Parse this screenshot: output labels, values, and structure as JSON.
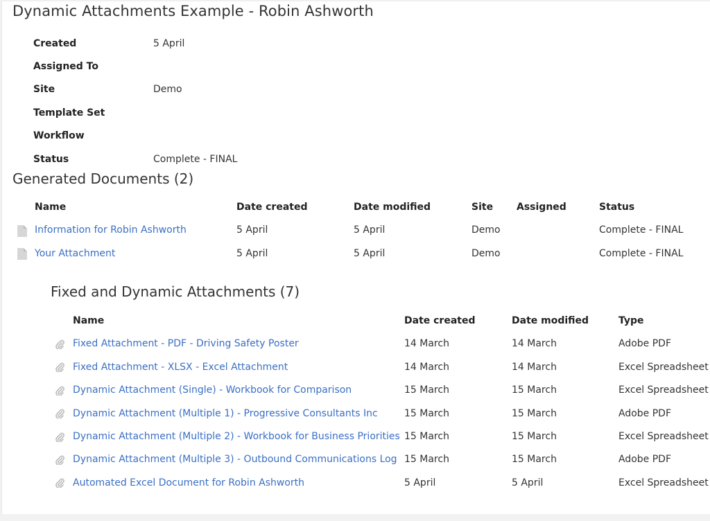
{
  "page": {
    "title": "Dynamic Attachments Example - Robin Ashworth"
  },
  "properties": [
    {
      "label": "Created",
      "value": "5 April"
    },
    {
      "label": "Assigned To",
      "value": ""
    },
    {
      "label": "Site",
      "value": "Demo"
    },
    {
      "label": "Template Set",
      "value": ""
    },
    {
      "label": "Workflow",
      "value": ""
    },
    {
      "label": "Status",
      "value": "Complete - FINAL"
    }
  ],
  "generated_documents": {
    "title": "Generated Documents (2)",
    "columns": [
      "Name",
      "Date created",
      "Date modified",
      "Site",
      "Assigned",
      "Status"
    ],
    "icon": "document-icon",
    "rows": [
      {
        "name": "Information for Robin Ashworth",
        "date_created": "5 April",
        "date_modified": "5 April",
        "site": "Demo",
        "assigned": "",
        "status": "Complete - FINAL"
      },
      {
        "name": "Your Attachment",
        "date_created": "5 April",
        "date_modified": "5 April",
        "site": "Demo",
        "assigned": "",
        "status": "Complete - FINAL"
      }
    ]
  },
  "attachments": {
    "title": "Fixed and Dynamic Attachments (7)",
    "columns": [
      "Name",
      "Date created",
      "Date modified",
      "Type"
    ],
    "icon": "paperclip-icon",
    "rows": [
      {
        "name": "Fixed Attachment - PDF - Driving Safety Poster",
        "date_created": "14 March",
        "date_modified": "14 March",
        "type": "Adobe PDF"
      },
      {
        "name": "Fixed Attachment - XLSX - Excel Attachment",
        "date_created": "14 March",
        "date_modified": "14 March",
        "type": "Excel Spreadsheet"
      },
      {
        "name": "Dynamic Attachment (Single) - Workbook for Comparison",
        "date_created": "15 March",
        "date_modified": "15 March",
        "type": "Excel Spreadsheet"
      },
      {
        "name": "Dynamic Attachment (Multiple 1) - Progressive Consultants Inc",
        "date_created": "15 March",
        "date_modified": "15 March",
        "type": "Adobe PDF"
      },
      {
        "name": "Dynamic Attachment (Multiple 2) - Workbook for Business Priorities",
        "date_created": "15 March",
        "date_modified": "15 March",
        "type": "Excel Spreadsheet"
      },
      {
        "name": "Dynamic Attachment (Multiple 3) - Outbound Communications Log",
        "date_created": "15 March",
        "date_modified": "15 March",
        "type": "Adobe PDF"
      },
      {
        "name": "Automated Excel Document for Robin Ashworth",
        "date_created": "5 April",
        "date_modified": "5 April",
        "type": "Excel Spreadsheet"
      }
    ]
  },
  "colors": {
    "link": "#3a6fc4",
    "text": "#333333",
    "icon": "#c8c8c8",
    "background": "#f2f2f2"
  }
}
